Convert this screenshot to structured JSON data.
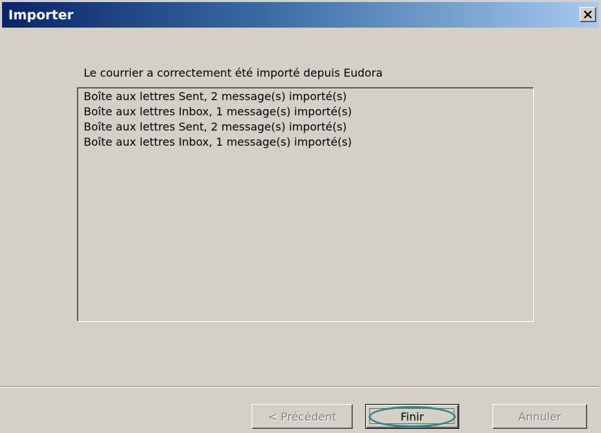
{
  "window": {
    "title": "Importer",
    "close_label": "×"
  },
  "main": {
    "message": "Le courrier a correctement été importé depuis Eudora",
    "log_lines": [
      "Boîte aux lettres Sent, 2 message(s) importé(s)",
      "Boîte aux lettres Inbox, 1 message(s) importé(s)",
      "Boîte aux lettres Sent, 2 message(s) importé(s)",
      "Boîte aux lettres Inbox, 1 message(s) importé(s)"
    ]
  },
  "buttons": {
    "previous": "< Précédent",
    "finish": "Finir",
    "cancel": "Annuler"
  },
  "colors": {
    "title_gradient_start": "#0a246a",
    "title_gradient_end": "#a6caf0",
    "window_bg": "#d4d0c8",
    "highlight_ring": "#2a8a8a"
  },
  "icons": {
    "close": "close-icon"
  }
}
